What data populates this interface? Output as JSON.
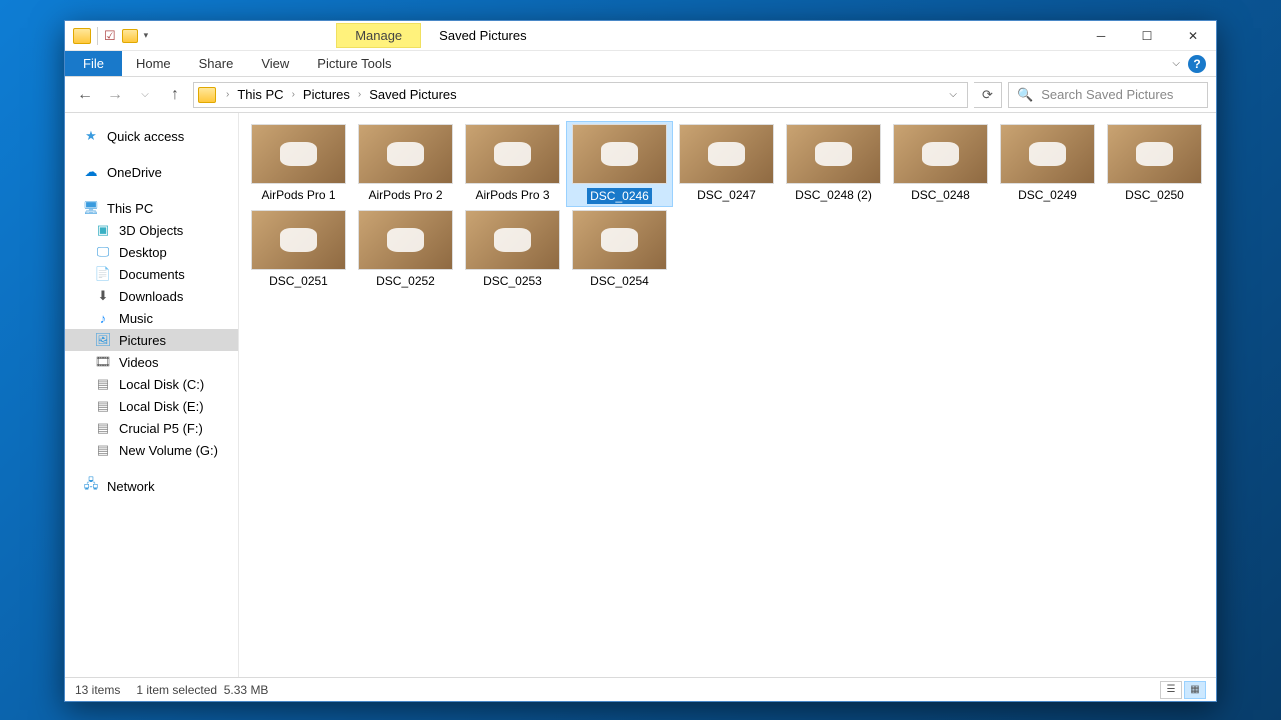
{
  "window": {
    "title": "Saved Pictures"
  },
  "ribbon": {
    "manage": "Manage",
    "tabs": {
      "file": "File",
      "home": "Home",
      "share": "Share",
      "view": "View",
      "picture_tools": "Picture Tools"
    }
  },
  "breadcrumb": {
    "items": [
      "This PC",
      "Pictures",
      "Saved Pictures"
    ]
  },
  "search": {
    "placeholder": "Search Saved Pictures"
  },
  "sidebar": {
    "quick_access": "Quick access",
    "onedrive": "OneDrive",
    "this_pc": "This PC",
    "objects3d": "3D Objects",
    "desktop": "Desktop",
    "documents": "Documents",
    "downloads": "Downloads",
    "music": "Music",
    "pictures": "Pictures",
    "videos": "Videos",
    "disk_c": "Local Disk (C:)",
    "disk_e": "Local Disk (E:)",
    "disk_f": "Crucial P5 (F:)",
    "disk_g": "New Volume (G:)",
    "network": "Network"
  },
  "files": [
    {
      "name": "AirPods Pro 1"
    },
    {
      "name": "AirPods Pro 2"
    },
    {
      "name": "AirPods Pro 3"
    },
    {
      "name": "DSC_0246",
      "selected": true,
      "editing": true
    },
    {
      "name": "DSC_0247"
    },
    {
      "name": "DSC_0248 (2)"
    },
    {
      "name": "DSC_0248"
    },
    {
      "name": "DSC_0249"
    },
    {
      "name": "DSC_0250"
    },
    {
      "name": "DSC_0251"
    },
    {
      "name": "DSC_0252"
    },
    {
      "name": "DSC_0253"
    },
    {
      "name": "DSC_0254"
    }
  ],
  "status": {
    "count": "13 items",
    "selection": "1 item selected",
    "size": "5.33 MB"
  }
}
